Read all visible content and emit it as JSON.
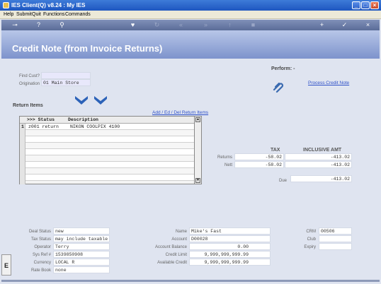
{
  "window": {
    "title": "IES Client(Q) v8.24 : My IES"
  },
  "menu": [
    "Help",
    "Submit",
    "Quit",
    "Functions",
    "Commands"
  ],
  "toolbar": {
    "icons": [
      "key-icon",
      "help-icon",
      "search-icon",
      "heart-icon",
      "refresh-icon",
      "rewind-icon",
      "fast-forward-icon",
      "up-icon",
      "stop-icon",
      "add-icon",
      "check-icon",
      "close-icon"
    ]
  },
  "page": {
    "title": "Credit Note (from Invoice Returns)"
  },
  "perform": {
    "label": "Perform: -",
    "process_link": "Process Credit Note"
  },
  "form": {
    "find_cust_label": "Find Cust?",
    "find_cust_value": "",
    "origination_label": "Origination",
    "origination_value": "01 Main Store"
  },
  "return_items": {
    "label": "Return Items",
    "add_link": "Add / Ed / Del Return Items",
    "headers": [
      ">>> Status",
      "Description"
    ],
    "rows": [
      {
        "num": "1",
        "status": "z001 return",
        "description": "NIKON COOLPIX 4100"
      }
    ]
  },
  "totals": {
    "tax_header": "TAX",
    "incl_header": "INCLUSIVE AMT",
    "returns_label": "Returns",
    "returns_tax": "-58.02",
    "returns_incl": "-413.02",
    "nett_label": "Nett",
    "nett_tax": "-58.02",
    "nett_incl": "-413.02",
    "due_label": "Due",
    "due_value": "-413.02"
  },
  "deal": {
    "status_label": "Deal Status",
    "status": "new",
    "tax_status_label": "Tax Status",
    "tax_status": "may include taxable a",
    "operator_label": "Operator",
    "operator": "Terry",
    "sys_ref_label": "Sys Ref #",
    "sys_ref": "1539850908",
    "currency_label": "Currency",
    "currency": "LOCAL R",
    "rate_book_label": "Rate Book",
    "rate_book": "none"
  },
  "account": {
    "name_label": "Name",
    "name": "Mike's Fast",
    "account_label": "Account",
    "account": "D00028",
    "balance_label": "Account Balance",
    "balance": "0.00",
    "credit_limit_label": "Credit Limit",
    "credit_limit": "9,999,999,999.99",
    "available_label": "Available Credit",
    "available": "9,999,999,999.99"
  },
  "crm": {
    "crm_label": "CRM",
    "crm": "00506",
    "club_label": "Club",
    "club": "",
    "expiry_label": "Expiry",
    "expiry": ""
  },
  "side_tab": "E"
}
